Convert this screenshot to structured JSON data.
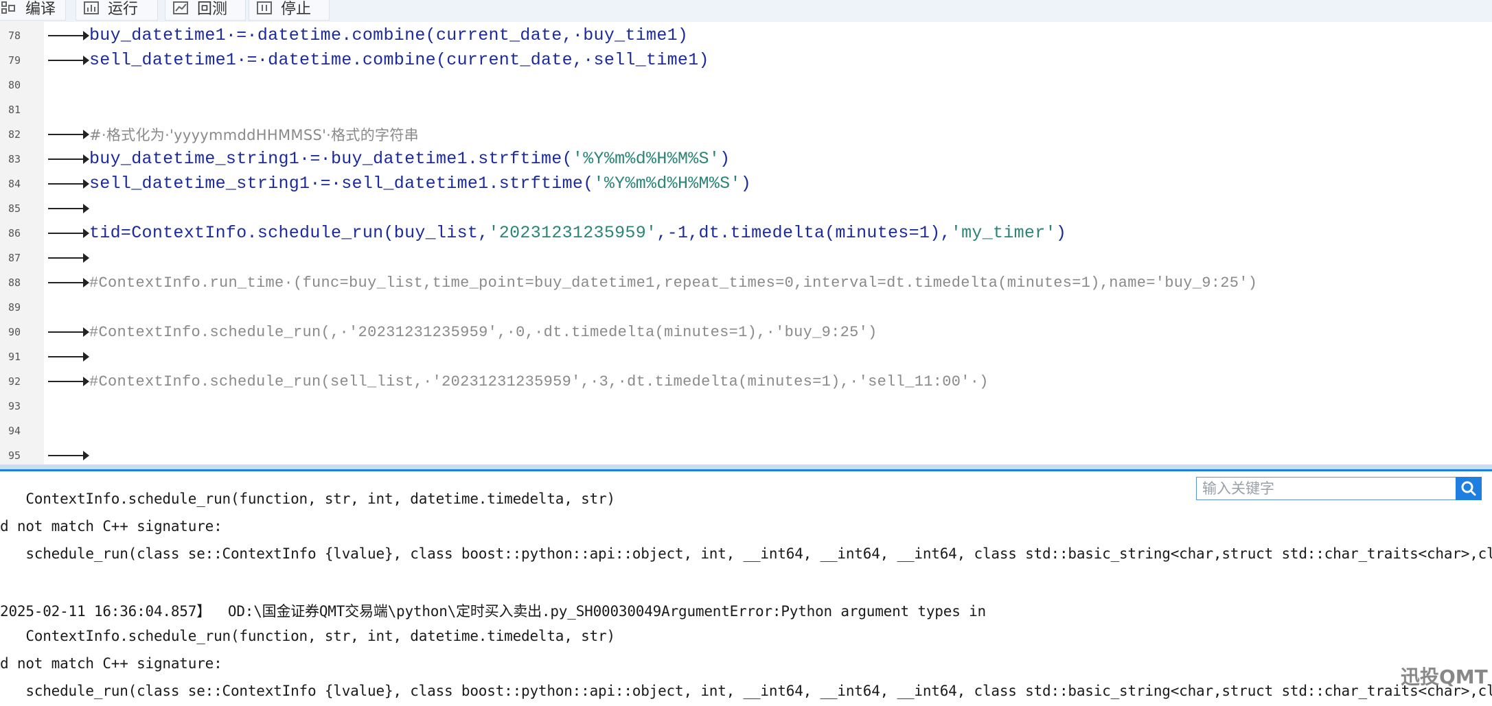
{
  "toolbar": {
    "compile_label": "编译",
    "run_label": "运行",
    "backtest_label": "回测",
    "stop_label": "停止"
  },
  "editor": {
    "lines": [
      {
        "no": "78",
        "code": "buy_datetime1·=·datetime.combine(current_date,·buy_time1)"
      },
      {
        "no": "79",
        "code": "sell_datetime1·=·datetime.combine(current_date,·sell_time1)"
      },
      {
        "no": "80",
        "code": ""
      },
      {
        "no": "81",
        "code": ""
      },
      {
        "no": "82",
        "code": "#·格式化为·'yyyymmddHHMMSS'·格式的字符串"
      },
      {
        "no": "83",
        "code_a": "buy_datetime_string1·=·buy_datetime1.strftime(",
        "code_s": "'%Y%m%d%H%M%S'",
        "code_b": ")"
      },
      {
        "no": "84",
        "code_a": "sell_datetime_string1·=·sell_datetime1.strftime(",
        "code_s": "'%Y%m%d%H%M%S'",
        "code_b": ")"
      },
      {
        "no": "85",
        "code": ""
      },
      {
        "no": "86",
        "code_a": "tid=ContextInfo.schedule_run(buy_list,",
        "code_s": "'20231231235959'",
        "code_b": ",-1,dt.timedelta(minutes=1),",
        "code_s2": "'my_timer'",
        "code_c": ")"
      },
      {
        "no": "87",
        "code": ""
      },
      {
        "no": "88",
        "code": "#ContextInfo.run_time·(func=buy_list,time_point=buy_datetime1,repeat_times=0,interval=dt.timedelta(minutes=1),name='buy_9:25')"
      },
      {
        "no": "89",
        "code": ""
      },
      {
        "no": "90",
        "code": "#ContextInfo.schedule_run(,·'20231231235959',·0,·dt.timedelta(minutes=1),·'buy_9:25')"
      },
      {
        "no": "91",
        "code": ""
      },
      {
        "no": "92",
        "code": "#ContextInfo.schedule_run(sell_list,·'20231231235959',·3,·dt.timedelta(minutes=1),·'sell_11:00'·)"
      },
      {
        "no": "93",
        "code": ""
      },
      {
        "no": "94",
        "code": ""
      },
      {
        "no": "95",
        "code": ""
      }
    ]
  },
  "output": {
    "search_placeholder": "输入关键字",
    "lines": [
      "   ContextInfo.schedule_run(function, str, int, datetime.timedelta, str)",
      "d not match C++ signature:",
      "   schedule_run(class se::ContextInfo {lvalue}, class boost::python::api::object, int, __int64, __int64, __int64, class std::basic_string<char,struct std::char_traits<char>,class std::allocator<char> >)",
      "",
      "2025-02-11 16:36:04.857】  OD:\\国金证券QMT交易端\\python\\定时买入卖出.py_SH00030049ArgumentError:Python argument types in",
      "   ContextInfo.schedule_run(function, str, int, datetime.timedelta, str)",
      "d not match C++ signature:",
      "   schedule_run(class se::ContextInfo {lvalue}, class boost::python::api::object, int, __int64, __int64, __int64, class std::basic_string<char,struct std::char_traits<char>,class std::allocator<char> >)"
    ]
  },
  "watermark": {
    "text": "迅投QMT"
  }
}
